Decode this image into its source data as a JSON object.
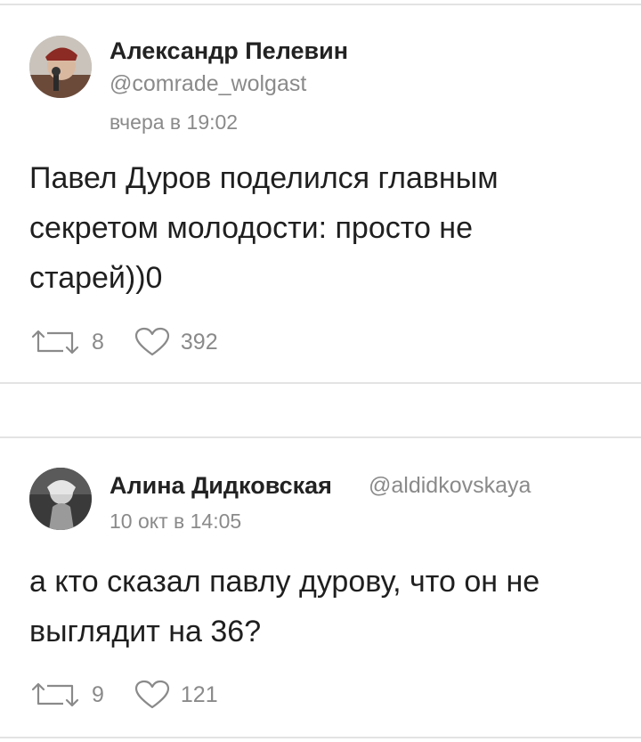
{
  "posts": [
    {
      "author_name": "Александр Пелевин",
      "handle": "@comrade_wolgast",
      "timestamp": "вчера в 19:02",
      "text_lines": [
        "Павел Дуров поделился главным",
        "секретом молодости: просто не",
        "старей))0"
      ],
      "reposts": "8",
      "likes": "392"
    },
    {
      "author_name": "Алина Дидковская",
      "handle": "@aldidkovskaya",
      "timestamp": "10 окт в 14:05",
      "text_lines": [
        "а кто сказал павлу дурову, что он не",
        "выглядит на 36?"
      ],
      "reposts": "9",
      "likes": "121"
    }
  ],
  "icons": {
    "repost": "repost-icon",
    "like": "heart-icon"
  },
  "colors": {
    "text": "#1f1f1f",
    "muted": "#8a8a8a",
    "divider": "#e3e3e3"
  }
}
